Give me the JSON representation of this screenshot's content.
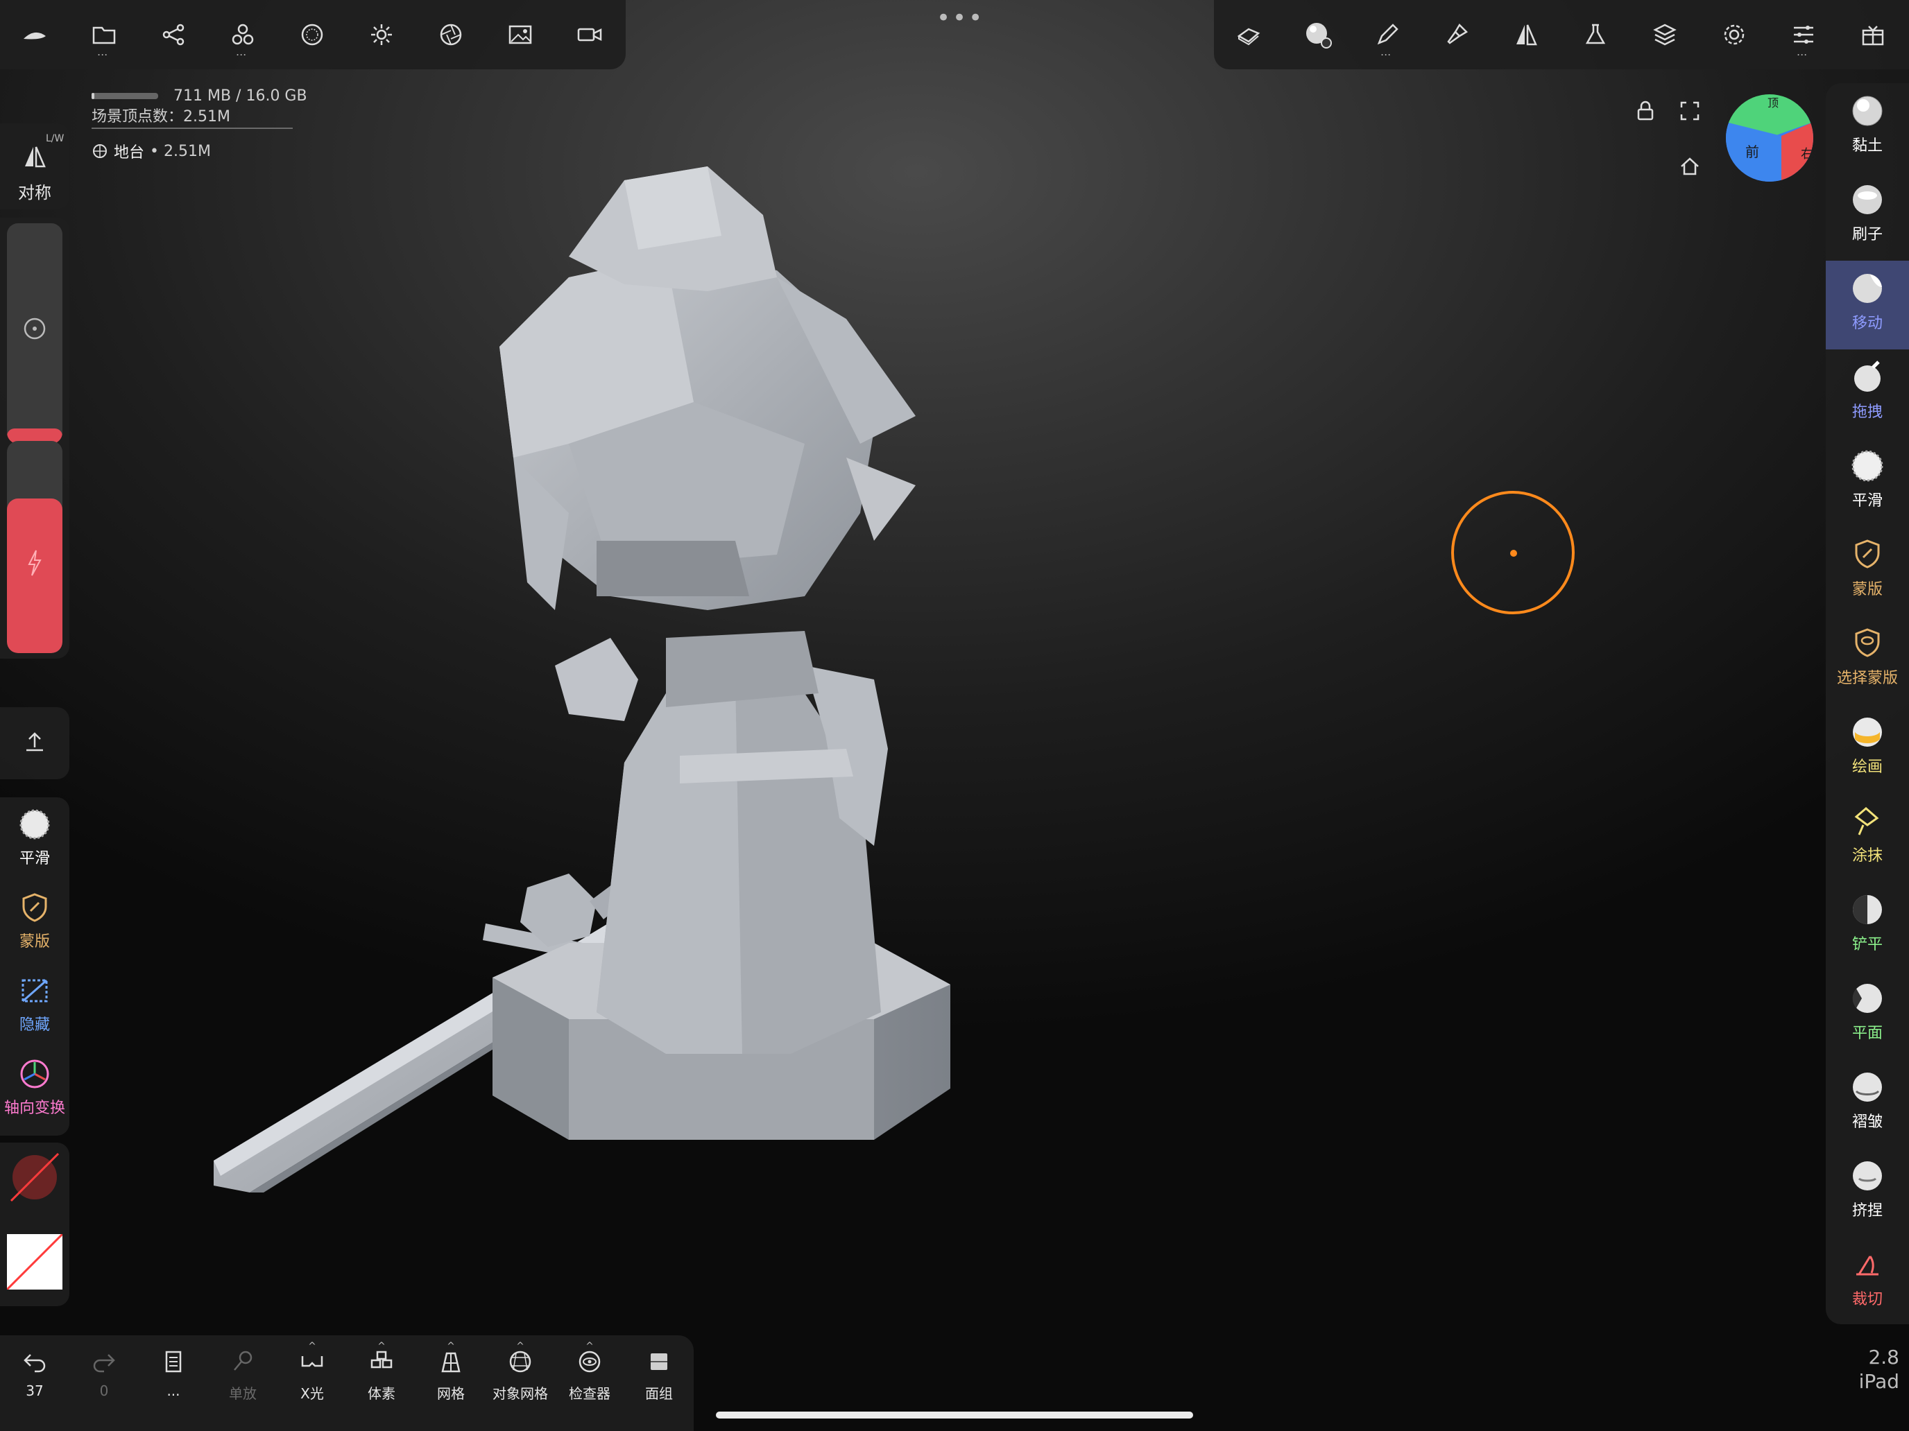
{
  "status": {
    "memory_used_fraction": 0.045,
    "memory_text": "711 MB / 16.0 GB",
    "vertex_count": "场景顶点数：2.51M",
    "object_name": "地台",
    "object_vertices": "• 2.51M"
  },
  "top_toolbar_left": {
    "icons": [
      "nomad-logo-icon",
      "folder-icon",
      "scene-tree-icon",
      "primitives-icon",
      "material-sphere-icon",
      "light-sun-icon",
      "post-process-aperture-icon",
      "background-image-icon",
      "camera-icon"
    ],
    "more_indicator": "..."
  },
  "top_toolbar_right": {
    "icons": [
      "topology-icon",
      "matcap-settings-icon",
      "stroke-pen-icon",
      "paint-brush-icon",
      "symmetry-icon",
      "lab-flask-icon",
      "layers-icon",
      "settings-gear-icon",
      "interface-sliders-icon",
      "gift-icon"
    ],
    "more_indicator": "..."
  },
  "center_menu": "•••",
  "left_panel": {
    "symmetry_label": "对称",
    "symmetry_tag": "L/W",
    "quick_tools": [
      {
        "label": "平滑",
        "color": "#ffffff"
      },
      {
        "label": "蒙版",
        "color": "#e6b36a"
      },
      {
        "label": "隐藏",
        "color": "#6fa7ff"
      },
      {
        "label": "轴向变换",
        "color": "#ff7bd0"
      }
    ],
    "radius_fraction": 0.07,
    "intensity_fraction": 0.73
  },
  "right_tools": [
    {
      "label": "黏土",
      "color": "#ffffff",
      "icon": "clay-sphere-icon"
    },
    {
      "label": "刷子",
      "color": "#ffffff",
      "icon": "brush-sphere-icon"
    },
    {
      "label": "移动",
      "color": "#8e9bff",
      "icon": "move-sphere-icon"
    },
    {
      "label": "拖拽",
      "color": "#8e9bff",
      "icon": "drag-sphere-icon"
    },
    {
      "label": "平滑",
      "color": "#ffffff",
      "icon": "smooth-sphere-icon"
    },
    {
      "label": "蒙版",
      "color": "#e6b36a",
      "icon": "mask-shield-icon"
    },
    {
      "label": "选择蒙版",
      "color": "#e6b36a",
      "icon": "select-mask-icon"
    },
    {
      "label": "绘画",
      "color": "#f2e27a",
      "icon": "paint-sphere-icon"
    },
    {
      "label": "涂抹",
      "color": "#f2e27a",
      "icon": "smudge-icon"
    },
    {
      "label": "铲平",
      "color": "#8cf28c",
      "icon": "flatten-sphere-icon"
    },
    {
      "label": "平面",
      "color": "#8cf28c",
      "icon": "planar-sphere-icon"
    },
    {
      "label": "褶皱",
      "color": "#ffffff",
      "icon": "crease-sphere-icon"
    },
    {
      "label": "挤捏",
      "color": "#ffffff",
      "icon": "pinch-sphere-icon"
    },
    {
      "label": "裁切",
      "color": "#ff6a6a",
      "icon": "trim-icon"
    }
  ],
  "bottom_toolbar": [
    {
      "label": "37",
      "icon": "undo-icon",
      "disabled": false,
      "tick": false
    },
    {
      "label": "0",
      "icon": "redo-icon",
      "disabled": true,
      "tick": false
    },
    {
      "label": "...",
      "icon": "notes-icon",
      "disabled": false,
      "tick": false
    },
    {
      "label": "单放",
      "icon": "zoom-icon",
      "disabled": true,
      "tick": false
    },
    {
      "label": "X光",
      "icon": "xray-glasses-icon",
      "disabled": false,
      "tick": true
    },
    {
      "label": "体素",
      "icon": "voxel-icon",
      "disabled": false,
      "tick": true
    },
    {
      "label": "网格",
      "icon": "grid-icon",
      "disabled": false,
      "tick": true
    },
    {
      "label": "对象网格",
      "icon": "object-wireframe-icon",
      "disabled": false,
      "tick": true
    },
    {
      "label": "检查器",
      "icon": "inspector-eye-icon",
      "disabled": false,
      "tick": true
    },
    {
      "label": "面组",
      "icon": "facegroup-icon",
      "disabled": false,
      "tick": false
    }
  ],
  "gizmo": {
    "front": "前",
    "right": "右",
    "top": "顶"
  },
  "version": {
    "number": "2.8",
    "device": "iPad"
  },
  "colors": {
    "accent": "#e04a55",
    "active_tool": "#3f4773",
    "brush_cursor": "#ff8a1c"
  }
}
